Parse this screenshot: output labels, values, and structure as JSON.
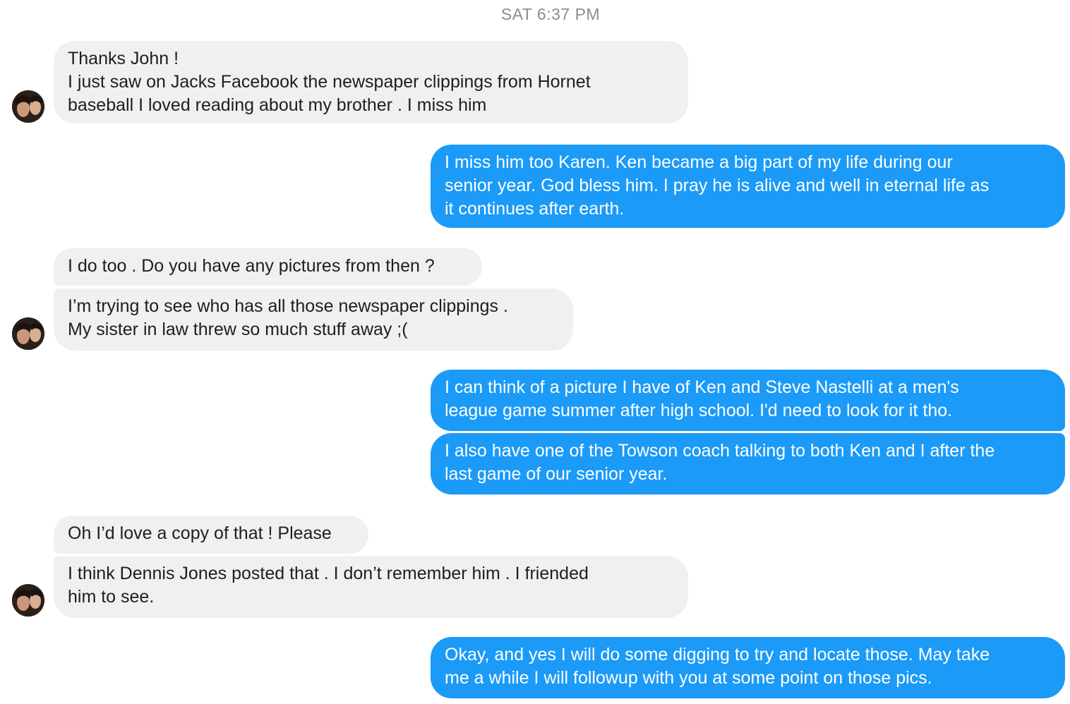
{
  "header": {
    "timestamp": "SAT 6:37 PM"
  },
  "contact": {
    "avatar_icon": "contact-avatar"
  },
  "colors": {
    "incoming_bg": "#f0f0f0",
    "outgoing_bg": "#1b9af7",
    "outgoing_text": "#ffffff",
    "timestamp": "#8a8d91"
  },
  "messages": [
    {
      "sender": "them",
      "text": "Thanks John !\nI just saw on Jacks Facebook the newspaper clippings from Hornet\nbaseball I loved reading about my brother . I miss him"
    },
    {
      "sender": "me",
      "text": "I miss him too Karen. Ken became a big part of my life during our\nsenior year. God bless him. I pray he is alive and well in eternal life as\nit continues after earth."
    },
    {
      "sender": "them",
      "text": "I do too . Do you have any pictures from then ?"
    },
    {
      "sender": "them",
      "text": "I’m trying to see who has all those newspaper clippings .\nMy sister in law threw so much stuff away ;("
    },
    {
      "sender": "me",
      "text": "I can think of a picture I have of Ken and Steve Nastelli at a men's\nleague game summer after high school. I'd need to look for it tho."
    },
    {
      "sender": "me",
      "text": "I also have one of the Towson coach talking to both Ken and I after the\nlast game of our senior year."
    },
    {
      "sender": "them",
      "text": "Oh I’d love a copy of that ! Please"
    },
    {
      "sender": "them",
      "text": "I think Dennis Jones posted that . I don’t remember him . I friended\nhim to see."
    },
    {
      "sender": "me",
      "text": "Okay, and yes I will do some digging to try and locate those. May take\nme a while I will followup with you at some point on those pics."
    }
  ]
}
